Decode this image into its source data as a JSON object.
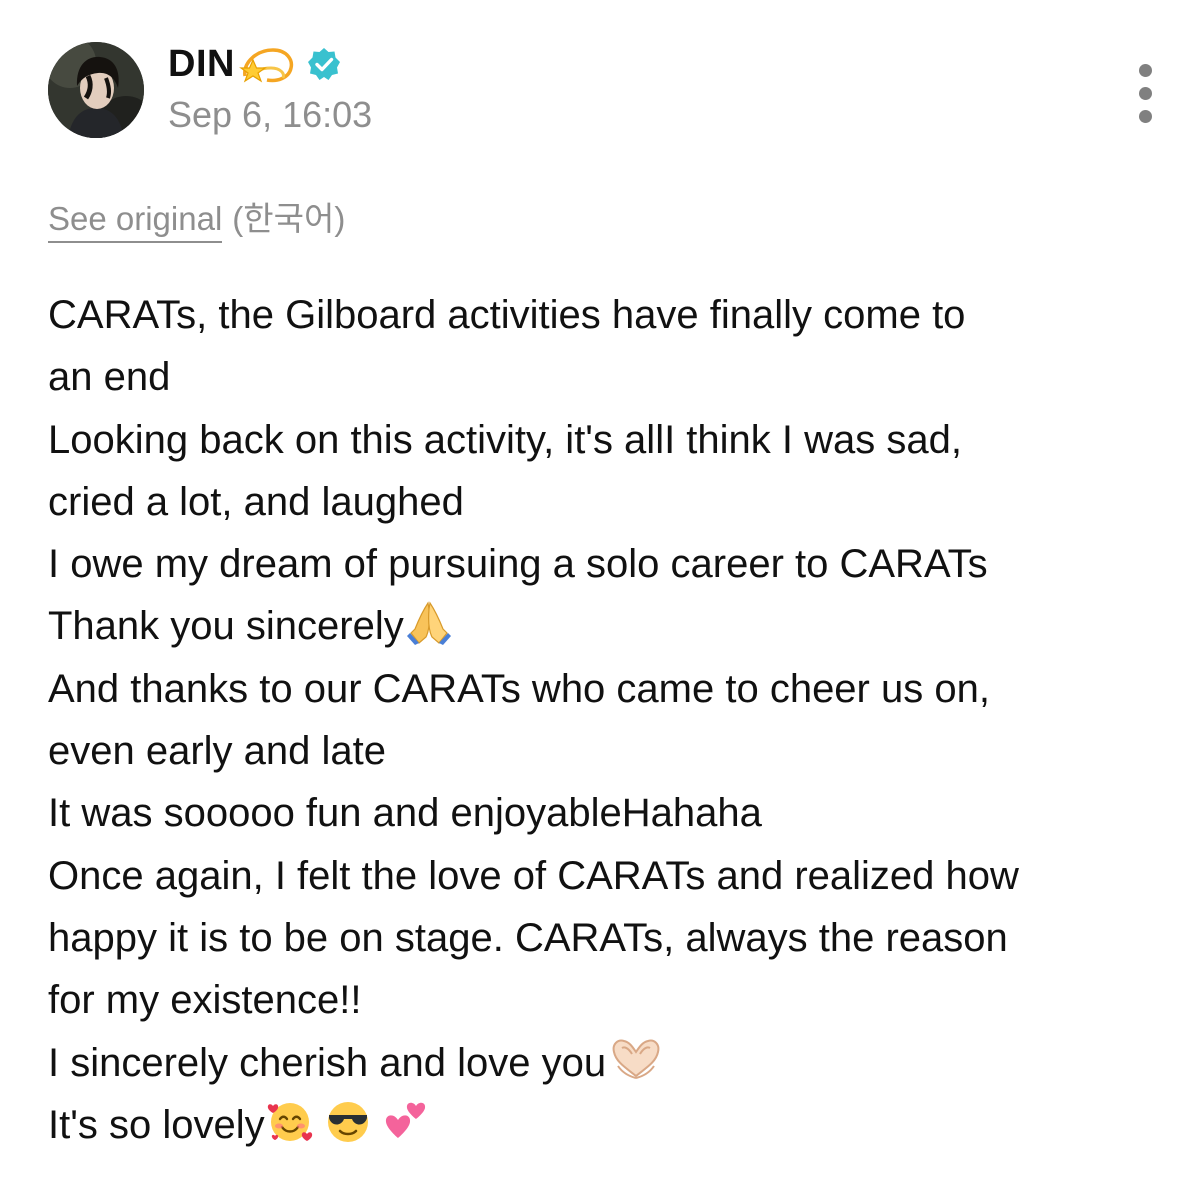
{
  "post": {
    "author": {
      "name": "DIN",
      "name_emoji": "dizzy-star-emoji",
      "verified_icon": "verified-badge-icon",
      "verified_color": "#39c1cf"
    },
    "timestamp": "Sep 6, 16:03",
    "more_icon": "more-vertical-icon",
    "translation": {
      "see_original_label": "See original",
      "language": "(한국어)"
    },
    "lines": [
      "CARATs, the Gilboard activities have finally come to",
      "an end",
      "Looking back on this activity, it's allI think I was sad,",
      "cried a lot, and laughed",
      "I owe my dream of pursuing a solo career to CARATs",
      "Thank you sincerely",
      "And thanks to our CARATs who came to cheer us on,",
      "even early and late",
      "It was sooooo fun and enjoyableHahaha",
      "Once again, I felt the love of CARATs and realized how",
      "happy it is to be on stage. CARATs, always the reason",
      "for my existence!!",
      "I sincerely cherish and love you",
      "It's so lovely"
    ],
    "inline_emojis": {
      "line_6": "folded-hands-emoji",
      "line_13": "heart-hands-emoji",
      "line_14": [
        "smiling-face-with-hearts-emoji",
        "smiling-face-with-sunglasses-emoji",
        "two-hearts-emoji"
      ]
    }
  }
}
